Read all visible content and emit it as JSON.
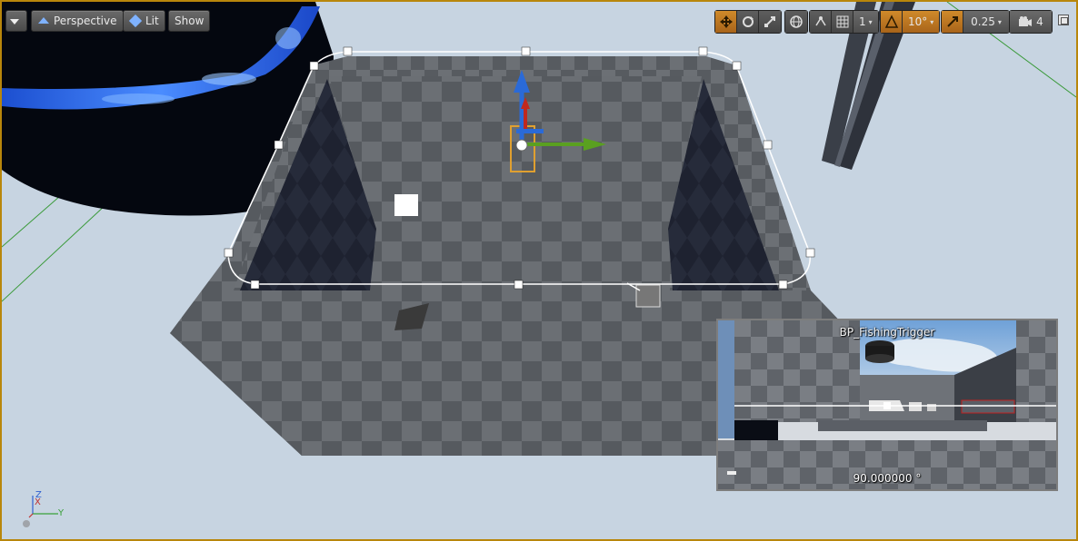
{
  "toolbar": {
    "menu_label": "",
    "view_mode": "Perspective",
    "lighting": "Lit",
    "show": "Show",
    "grid_snap_value": "1",
    "rotation_snap_value": "10°",
    "scale_snap_value": "0.25",
    "camera_speed_value": "4"
  },
  "preview": {
    "title": "BP_FishingTrigger",
    "angle": "90.000000 °"
  },
  "axis": {
    "z": "Z",
    "x": "X",
    "y": "Y"
  },
  "colors": {
    "viewport_border": "#b8860b",
    "sky": "#c9d6e2",
    "active_orange": "#d08a2a",
    "gizmo_x": "#c0281e",
    "gizmo_y": "#5aa020",
    "gizmo_z": "#2a6ad8"
  }
}
